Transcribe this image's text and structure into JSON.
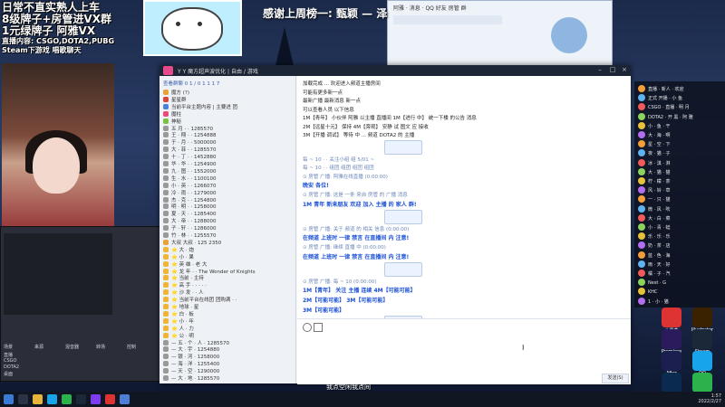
{
  "stream_overlay": {
    "line1": "日常不直实熟人上车",
    "line2": "8级牌子+房管进VX群",
    "line3": "1元绿牌子 阿雅VX",
    "line4": "直播内容: CSGO,DOTA2,PUBG",
    "line5": "Steam下游戏 唱歌聊天",
    "thanks": "感谢上周榜一: 甄颖 — 泽"
  },
  "qq_window": {
    "title": "Y Y 魔方超声波优化 | 自由 / 游戏",
    "group_header": "查看群聊 0 1 / 0 1 1 1 7",
    "groups": [
      {
        "name": "魔方 (?)",
        "color": "#e8a23a"
      },
      {
        "name": "星星群",
        "color": "#d9453a"
      },
      {
        "name": "当前平台主题内容 | 主要进 团",
        "color": "#4e7fd6"
      },
      {
        "name": "魔柱",
        "color": "#e94a7a"
      },
      {
        "name": "神秘",
        "color": "#7ac043"
      },
      {
        "name": "五 月 · · 1285570",
        "color": "#999"
      },
      {
        "name": "王 · 翔 · · 1254888",
        "color": "#999"
      },
      {
        "name": "于 · 月 · · 5000000",
        "color": "#999"
      },
      {
        "name": "大 · 菲 · · 1285570",
        "color": "#999"
      },
      {
        "name": "十 · 丁 · · 1452880",
        "color": "#999"
      },
      {
        "name": "华 · 华 · · 1254900",
        "color": "#999"
      },
      {
        "name": "九 · 图 · · 1552000",
        "color": "#999"
      },
      {
        "name": "生 · 水 · · 1100100",
        "color": "#999"
      },
      {
        "name": "小 · 英 · · 1266070",
        "color": "#999"
      },
      {
        "name": "冷 · 雨 · · 1279000",
        "color": "#999"
      },
      {
        "name": "杰 · 克 · · 1254800",
        "color": "#999"
      },
      {
        "name": "明 · 明 · · 1258000",
        "color": "#999"
      },
      {
        "name": "夏 · 天 · · 1285400",
        "color": "#999"
      },
      {
        "name": "大 · 帝 · · 1288000",
        "color": "#999"
      },
      {
        "name": "子 · 轩 · · 1286000",
        "color": "#999"
      },
      {
        "name": "竹 · 林 · · 1255570",
        "color": "#999"
      },
      {
        "name": "大叔 大叔 · 125 2350",
        "color": "#e8a23a"
      },
      {
        "name": "⭐ 大 · 炮",
        "color": "#f0b43a"
      },
      {
        "name": "⭐ 小 · 果",
        "color": "#f0b43a"
      },
      {
        "name": "⭐ 英 雄 · 老 大",
        "color": "#f0b43a"
      },
      {
        "name": "⭐ 龙 年 · · The Wonder of Knights",
        "color": "#f0b43a"
      },
      {
        "name": "⭐ 当前 · 主持",
        "color": "#f0b43a"
      },
      {
        "name": "⭐ 高 手 · · · · ·",
        "color": "#f0b43a"
      },
      {
        "name": "⭐ 沙 发 · · 人",
        "color": "#f0b43a"
      },
      {
        "name": "⭐ 当前平台在线团 团购满 · ·",
        "color": "#f0b43a"
      },
      {
        "name": "⭐ 地球 · 星",
        "color": "#f0b43a"
      },
      {
        "name": "⭐ 白 · 板",
        "color": "#f0b43a"
      },
      {
        "name": "⭐ 小 · 年",
        "color": "#f0b43a"
      },
      {
        "name": "⭐ 人 · 力",
        "color": "#f0b43a"
      },
      {
        "name": "⭐ 公 · 明",
        "color": "#f0b43a"
      },
      {
        "name": "— 五 · 个 · 人 · 1285570",
        "color": "#999"
      },
      {
        "name": "— 大 · 宇 · 1254880",
        "color": "#999"
      },
      {
        "name": "— 银 · 河 · 1258000",
        "color": "#999"
      },
      {
        "name": "— 海 · 洋 · 1255400",
        "color": "#999"
      },
      {
        "name": "— 天 · 空 · 1290000",
        "color": "#999"
      },
      {
        "name": "— 大 · 地 · 1285570",
        "color": "#999"
      }
    ],
    "messages": [
      {
        "cls": "dark",
        "text": "加载完成 ... 欢迎进入频道主播房间"
      },
      {
        "cls": "dark",
        "text": "可能有更多新一点"
      },
      {
        "cls": "dark",
        "text": "最新广播 最新消息 新一点"
      },
      {
        "cls": "dark",
        "text": "可以查看人员 以下信息"
      },
      {
        "cls": "dark",
        "text": "1M【青年】 小伙伴 阿雅 以主播 直播间 1M【进行 中】 统一下楼 的公告 消息"
      },
      {
        "cls": "dark",
        "text": "2M【远星十元】 保持      4M【旁观】 安静 试 图文 应 接收"
      },
      {
        "cls": "dark",
        "text": "3M【开播 调试】 等待 中 ... 频道 DOTA2 的 主播"
      },
      {
        "cls": "meta",
        "text": "每 ~ 10 ·   · 关注小组 组     5/01 ~"
      },
      {
        "cls": "meta",
        "text": "每 ~ 10 ·   · 组团 组团 组团 组团"
      },
      {
        "cls": "meta",
        "text": "⊙ 房管 广播: 阿雅在线直播 (0:00:00)"
      },
      {
        "cls": "blue",
        "text": "晚安 各位!"
      },
      {
        "cls": "meta",
        "text": "⊙ 房管 广播: 这是 一条 来自 房管 的 广播 消息"
      },
      {
        "cls": "blue",
        "text": "1M 青年  新来朋友 欢迎 加入 主播 的 家人 群!"
      },
      {
        "cls": "meta",
        "text": "⊙ 房管 广播: 关于 频道 的 相关 信息 (0:00:00)"
      },
      {
        "cls": "blue",
        "text": "在频道 上班时 一律 禁言 在直播间 内 注意!"
      },
      {
        "cls": "meta",
        "text": "⊙ 房管 广播: 继续 直播 中 (0:00:00)"
      },
      {
        "cls": "blue",
        "text": "在频道 上班时 一律 禁言 在直播间 内 注意!"
      },
      {
        "cls": "meta",
        "text": "⊙ 房管 广播: 每 ~ 10 (0:00:00)"
      },
      {
        "cls": "blue",
        "text": "1M【青年】 关注 主播     连续     4M【可能可能】"
      },
      {
        "cls": "blue",
        "text": "2M【可能可能】           3M【可能可能】"
      },
      {
        "cls": "blue",
        "text": "3M【可能可能】"
      },
      {
        "cls": "meta",
        "text": "⊙ 房管 广播: 以下 为 主播 通知 (0:00:00)"
      },
      {
        "cls": "red",
        "text": "1M【青年】 小伙伴 直播 中 可 以 的 主播 频道       4M【可能】 统一 下 楼 的 公告"
      },
      {
        "cls": "red",
        "text": "2M【远星十元】 保持                 5M【旁观】 安静 试 图文 应 接收"
      },
      {
        "cls": "red",
        "text": "3M【开播调试】 等待 中 (CSGO DOTA2) 的 主播"
      }
    ],
    "send_label": "发送(S)"
  },
  "small_qq": {
    "title": "阿雅 · 消息 · QQ 好友 房管 群"
  },
  "right_panel": {
    "items": [
      {
        "name": "直播 · 新人 · 欢迎",
        "color": "#f29f3a"
      },
      {
        "name": "正式 开播 · 小 鱼",
        "color": "#5fb4f0"
      },
      {
        "name": "CSGO · 直播 · 明 月",
        "color": "#f05a5a"
      },
      {
        "name": "DOTA2 · 开 黑 · 阿 雅",
        "color": "#8bd35e"
      },
      {
        "name": "小 · 鱼 · 干",
        "color": "#e5c23a"
      },
      {
        "name": "大 · 海 · 啊",
        "color": "#b26ef0"
      },
      {
        "name": "星 · 空 · 下",
        "color": "#f29f3a"
      },
      {
        "name": "夜 · 猫 · 子",
        "color": "#5fb4f0"
      },
      {
        "name": "冰 · 淇 · 淋",
        "color": "#f05a5a"
      },
      {
        "name": "大 · 猫 · 猫",
        "color": "#8bd35e"
      },
      {
        "name": "柠 · 檬 · 茶",
        "color": "#e5c23a"
      },
      {
        "name": "风 · 铃 · 草",
        "color": "#b26ef0"
      },
      {
        "name": "一 · 只 · 猫",
        "color": "#f29f3a"
      },
      {
        "name": "微 · 风 · 吹",
        "color": "#5fb4f0"
      },
      {
        "name": "大 · 白 · 菜",
        "color": "#f05a5a"
      },
      {
        "name": "小 · 青 · 蛙",
        "color": "#8bd35e"
      },
      {
        "name": "乐 · 乐 · 乐",
        "color": "#e5c23a"
      },
      {
        "name": "奶 · 茶 · 店",
        "color": "#b26ef0"
      },
      {
        "name": "蓝 · 色 · 海",
        "color": "#f29f3a"
      },
      {
        "name": "雨 · 天 · 好",
        "color": "#5fb4f0"
      },
      {
        "name": "橘 · 子 · 汽",
        "color": "#f05a5a"
      },
      {
        "name": "Nest · G",
        "color": "#8bd35e"
      },
      {
        "name": "KHC",
        "color": "#e5c23a"
      },
      {
        "name": "1 · 小 · 猫",
        "color": "#b26ef0"
      }
    ]
  },
  "obs": {
    "rows": [
      "场景",
      "来源",
      "混音器",
      "转场",
      "控制"
    ],
    "scenes": [
      "直播",
      "CSGO",
      "DOTA2",
      "桌面"
    ]
  },
  "subtitle": "我点空闲我点间",
  "clock": {
    "time": "1:57",
    "date": "2022/2/27"
  },
  "desktop_icons": [
    {
      "label": "小黑盒",
      "color": "#d33"
    },
    {
      "label": "Premiere",
      "color": "#2b1a5c"
    },
    {
      "label": "After Effects",
      "color": "#1a1f4f"
    },
    {
      "label": "Photoshop",
      "color": "#0a2b4f"
    },
    {
      "label": "Illustrator",
      "color": "#3a2200"
    },
    {
      "label": "Steam",
      "color": "#1b2838"
    },
    {
      "label": "QQ",
      "color": "#17a4e8"
    },
    {
      "label": "微信",
      "color": "#2bb24c"
    }
  ]
}
